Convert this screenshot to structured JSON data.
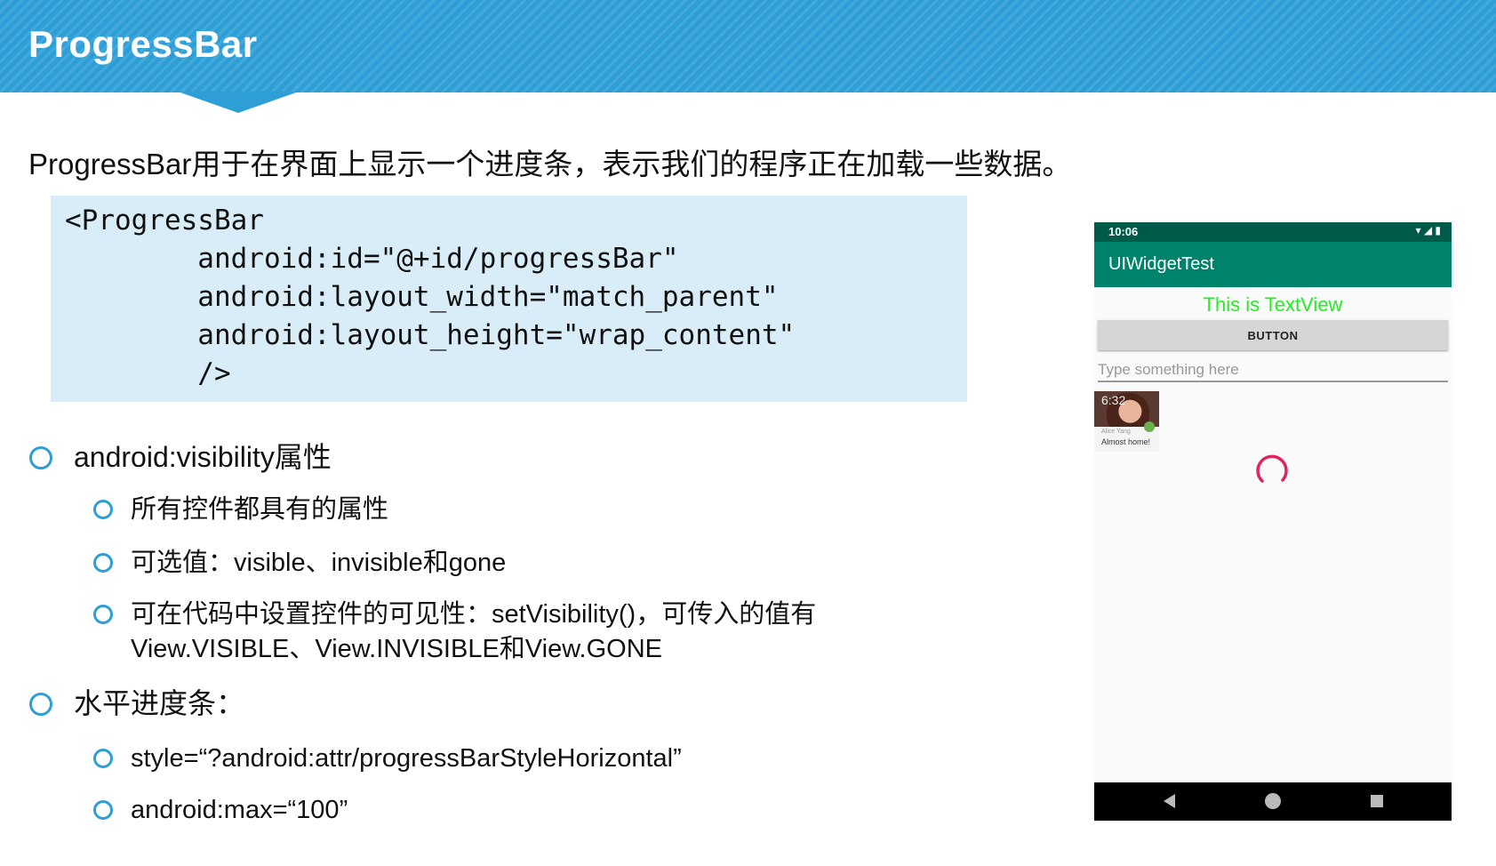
{
  "header": {
    "title": "ProgressBar",
    "color": "#2e9fd6"
  },
  "intro": "ProgressBar用于在界面上显示一个进度条，表示我们的程序正在加载一些数据。",
  "code": {
    "lines": [
      "<ProgressBar",
      "        android:id=\"@+id/progressBar\"",
      "        android:layout_width=\"match_parent\"",
      "        android:layout_height=\"wrap_content\"",
      "        />"
    ],
    "background": "#d9edf8"
  },
  "bullets": {
    "visibility": {
      "title": "android:visibility属性",
      "items": [
        "所有控件都具有的属性",
        "可选值：visible、invisible和gone",
        "可在代码中设置控件的可见性：setVisibility()，可传入的值有",
        "View.VISIBLE、View.INVISIBLE和View.GONE"
      ]
    },
    "horizontal": {
      "title": "水平进度条：",
      "items": [
        "style=“?android:attr/progressBarStyleHorizontal”",
        "android:max=“100”"
      ]
    }
  },
  "phone": {
    "status_time": "10:06",
    "app_title": "UIWidgetTest",
    "textview": "This is TextView",
    "button_label": "BUTTON",
    "input_placeholder": "Type something here",
    "image": {
      "time": "6:32",
      "name": "Alice Yang",
      "message": "Almost home!"
    },
    "colors": {
      "status_bar": "#005a4a",
      "app_bar": "#00836b",
      "textview": "#22ee22",
      "spinner": "#e0245e"
    }
  }
}
